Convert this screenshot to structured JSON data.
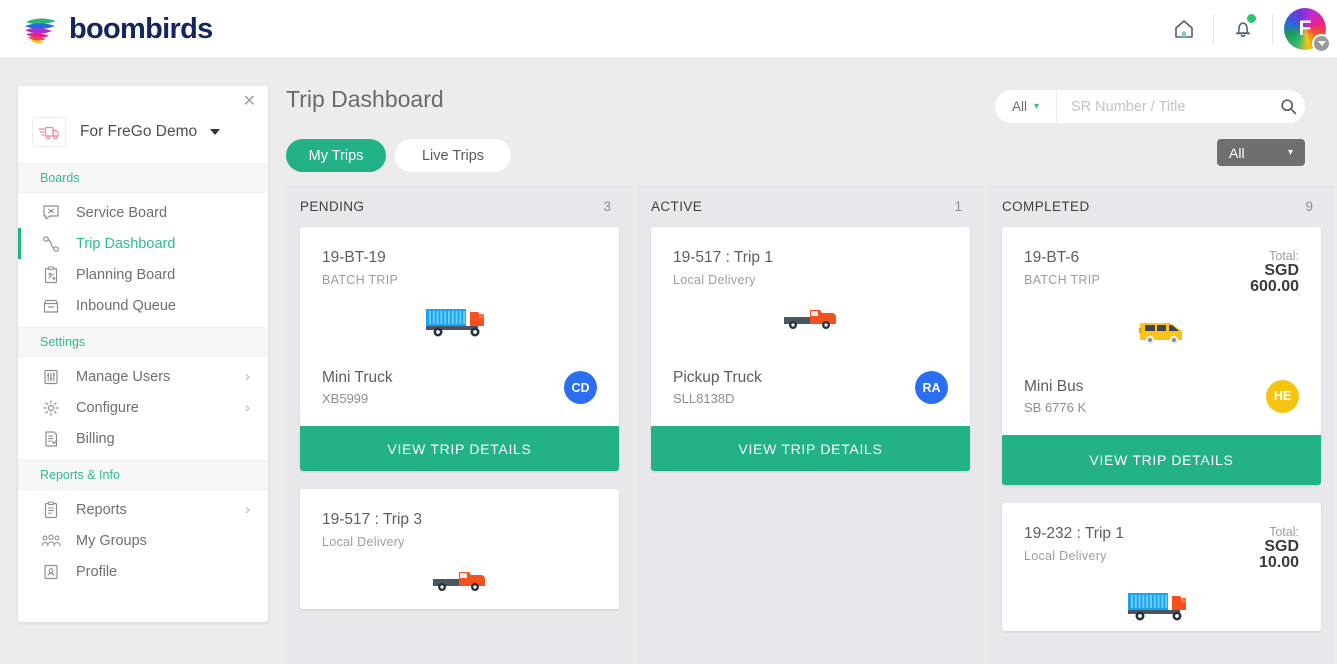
{
  "header": {
    "brand": "boombirds",
    "home_icon": "home-icon",
    "bell_icon": "bell-icon",
    "avatar_initial": "F",
    "accent": "#23b187"
  },
  "sidebar": {
    "close_label": "✕",
    "company": "For FreGo Demo",
    "sections": [
      {
        "title": "Boards",
        "items": [
          {
            "label": "Service Board",
            "icon": "service-board-icon",
            "active": false,
            "arrow": false
          },
          {
            "label": "Trip Dashboard",
            "icon": "trip-dashboard-icon",
            "active": true,
            "arrow": false
          },
          {
            "label": "Planning Board",
            "icon": "planning-board-icon",
            "active": false,
            "arrow": false
          },
          {
            "label": "Inbound Queue",
            "icon": "inbound-queue-icon",
            "active": false,
            "arrow": false
          }
        ]
      },
      {
        "title": "Settings",
        "items": [
          {
            "label": "Manage Users",
            "icon": "sliders-icon",
            "active": false,
            "arrow": true
          },
          {
            "label": "Configure",
            "icon": "gear-icon",
            "active": false,
            "arrow": true
          },
          {
            "label": "Billing",
            "icon": "billing-icon",
            "active": false,
            "arrow": false
          }
        ]
      },
      {
        "title": "Reports & Info",
        "items": [
          {
            "label": "Reports",
            "icon": "clipboard-icon",
            "active": false,
            "arrow": true
          },
          {
            "label": "My Groups",
            "icon": "people-icon",
            "active": false,
            "arrow": false
          },
          {
            "label": "Profile",
            "icon": "profile-icon",
            "active": false,
            "arrow": false
          }
        ]
      }
    ]
  },
  "main": {
    "title": "Trip Dashboard",
    "tabs": [
      {
        "label": "My Trips",
        "selected": true
      },
      {
        "label": "Live Trips",
        "selected": false
      }
    ],
    "search": {
      "scope": "All",
      "placeholder": "SR Number / Title",
      "value": "",
      "icon": "search-icon"
    },
    "filter": {
      "label": "All",
      "chevron": "▾"
    }
  },
  "columns": [
    {
      "title": "PENDING",
      "count": "3",
      "cards": [
        {
          "id": "19-BT-19",
          "subtitle": "BATCH TRIP",
          "vehicle_icon": "lorry-icon",
          "vehicle_name": "Mini Truck",
          "plate": "XB5999",
          "badge": "CD",
          "badge_color": "#2c6ef2",
          "button": "VIEW TRIP DETAILS",
          "total_label": "",
          "total_amount": ""
        },
        {
          "id": "19-517 : Trip 3",
          "subtitle": "Local Delivery",
          "vehicle_icon": "pickup-icon",
          "vehicle_name": "",
          "plate": "",
          "badge": "",
          "badge_color": "",
          "button": "",
          "total_label": "",
          "total_amount": ""
        }
      ]
    },
    {
      "title": "ACTIVE",
      "count": "1",
      "cards": [
        {
          "id": "19-517 : Trip 1",
          "subtitle": "Local Delivery",
          "vehicle_icon": "pickup-icon",
          "vehicle_name": "Pickup Truck",
          "plate": "SLL8138D",
          "badge": "RA",
          "badge_color": "#2c6ef2",
          "button": "VIEW TRIP DETAILS",
          "total_label": "",
          "total_amount": ""
        }
      ]
    },
    {
      "title": "COMPLETED",
      "count": "9",
      "cards": [
        {
          "id": "19-BT-6",
          "subtitle": "BATCH TRIP",
          "vehicle_icon": "bus-icon",
          "vehicle_name": "Mini Bus",
          "plate": "SB 6776 K",
          "badge": "HE",
          "badge_color": "#f3c511",
          "button": "VIEW TRIP DETAILS",
          "total_label": "Total:",
          "total_amount": "SGD 600.00"
        },
        {
          "id": "19-232 : Trip 1",
          "subtitle": "Local Delivery",
          "vehicle_icon": "lorry-icon",
          "vehicle_name": "",
          "plate": "",
          "badge": "",
          "badge_color": "",
          "button": "",
          "total_label": "Total:",
          "total_amount": "SGD 10.00"
        }
      ]
    }
  ]
}
